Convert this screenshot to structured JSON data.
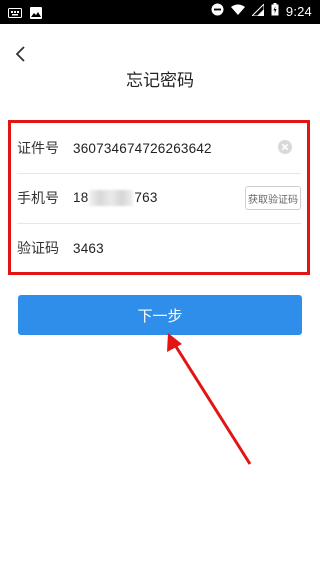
{
  "status_bar": {
    "time": "9:24",
    "left_icons": [
      "keyboard-icon",
      "image-icon"
    ],
    "right_icons": [
      "dnd-icon",
      "wifi-icon",
      "signal-icon",
      "battery-charging-icon"
    ]
  },
  "header": {
    "title": "忘记密码"
  },
  "form": {
    "id_label": "证件号",
    "id_value": "360734674726263642",
    "phone_label": "手机号",
    "phone_prefix": "18",
    "phone_suffix": "763",
    "get_code_button": "获取验证码",
    "code_label": "验证码",
    "code_value": "3463"
  },
  "next_button": "下一步",
  "colors": {
    "accent": "#2f8eea",
    "highlight_border": "#e21515",
    "arrow": "#e21515"
  }
}
